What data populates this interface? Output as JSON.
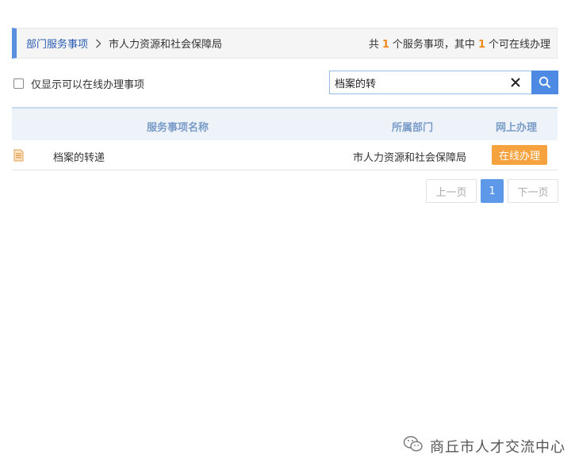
{
  "breadcrumb": {
    "parent": "部门服务事项",
    "current": "市人力资源和社会保障局"
  },
  "summary": {
    "prefix": "共",
    "total": "1",
    "middle": "个服务事项，其中",
    "online": "1",
    "suffix": "个可在线办理"
  },
  "filter": {
    "checkbox_label": "仅显示可以在线办理事项",
    "checked": false
  },
  "search": {
    "value": "档案的转"
  },
  "table": {
    "headers": {
      "name": "服务事项名称",
      "dept": "所属部门",
      "online": "网上办理"
    },
    "rows": [
      {
        "name": "档案的转递",
        "dept": "市人力资源和社会保障局",
        "action": "在线办理"
      }
    ]
  },
  "pagination": {
    "prev": "上一页",
    "current": "1",
    "next": "下一页"
  },
  "watermark": {
    "text": "商丘市人才交流中心"
  },
  "colors": {
    "accent": "#5a8fdf",
    "count_highlight": "#f08a1c",
    "online_button": "#f6a23e",
    "search_button": "#4d8ae4",
    "page_current": "#5d99e8"
  }
}
